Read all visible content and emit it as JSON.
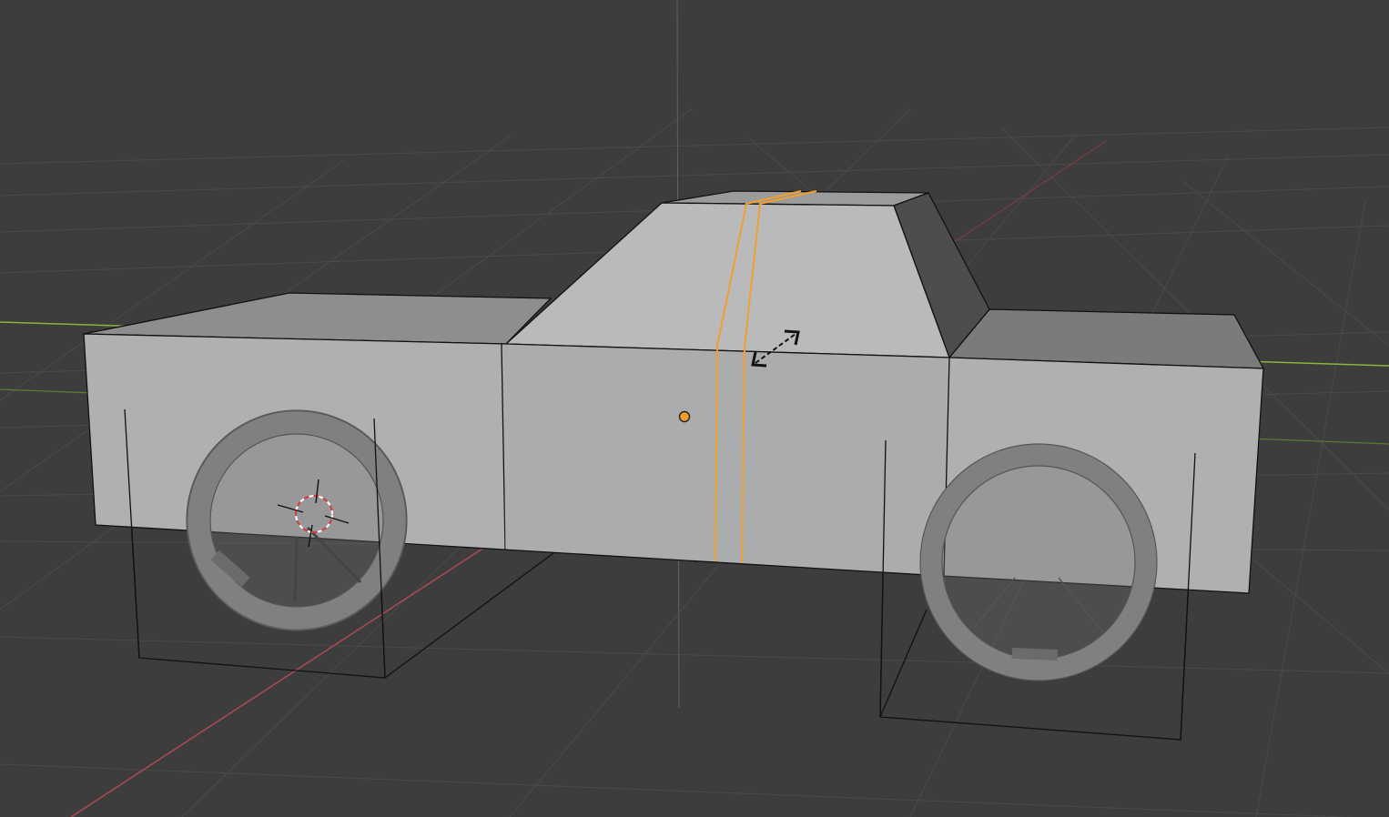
{
  "app": {
    "editor": "3D Viewport",
    "mode": "edit-mode",
    "active_tool": "loop-cut-and-slide"
  },
  "colors": {
    "background": "#3d3d3d",
    "grid_line": "#4d4d4d",
    "x_axis": "#a0474d",
    "y_axis": "#7fa83a",
    "z_axis": "#6a6a6a",
    "body_front": "#b4b5b6",
    "body_top": "#8d8e8f",
    "body_side_dark": "#5a5b5d",
    "cab_front": "#bbbcbd",
    "cab_top": "#9c9d9e",
    "cab_slope_dark": "#4a4b4d",
    "tire": "#8a8b8c",
    "tire_inner": "#6e6f70",
    "wire_edge": "#111111",
    "selected_edge": "#f0a030",
    "origin_dot": "#f0a030"
  },
  "icons": {
    "cursor": "3d-cursor-icon",
    "scale_cursor": "resize-double-arrow-icon",
    "origin": "object-origin-icon"
  }
}
